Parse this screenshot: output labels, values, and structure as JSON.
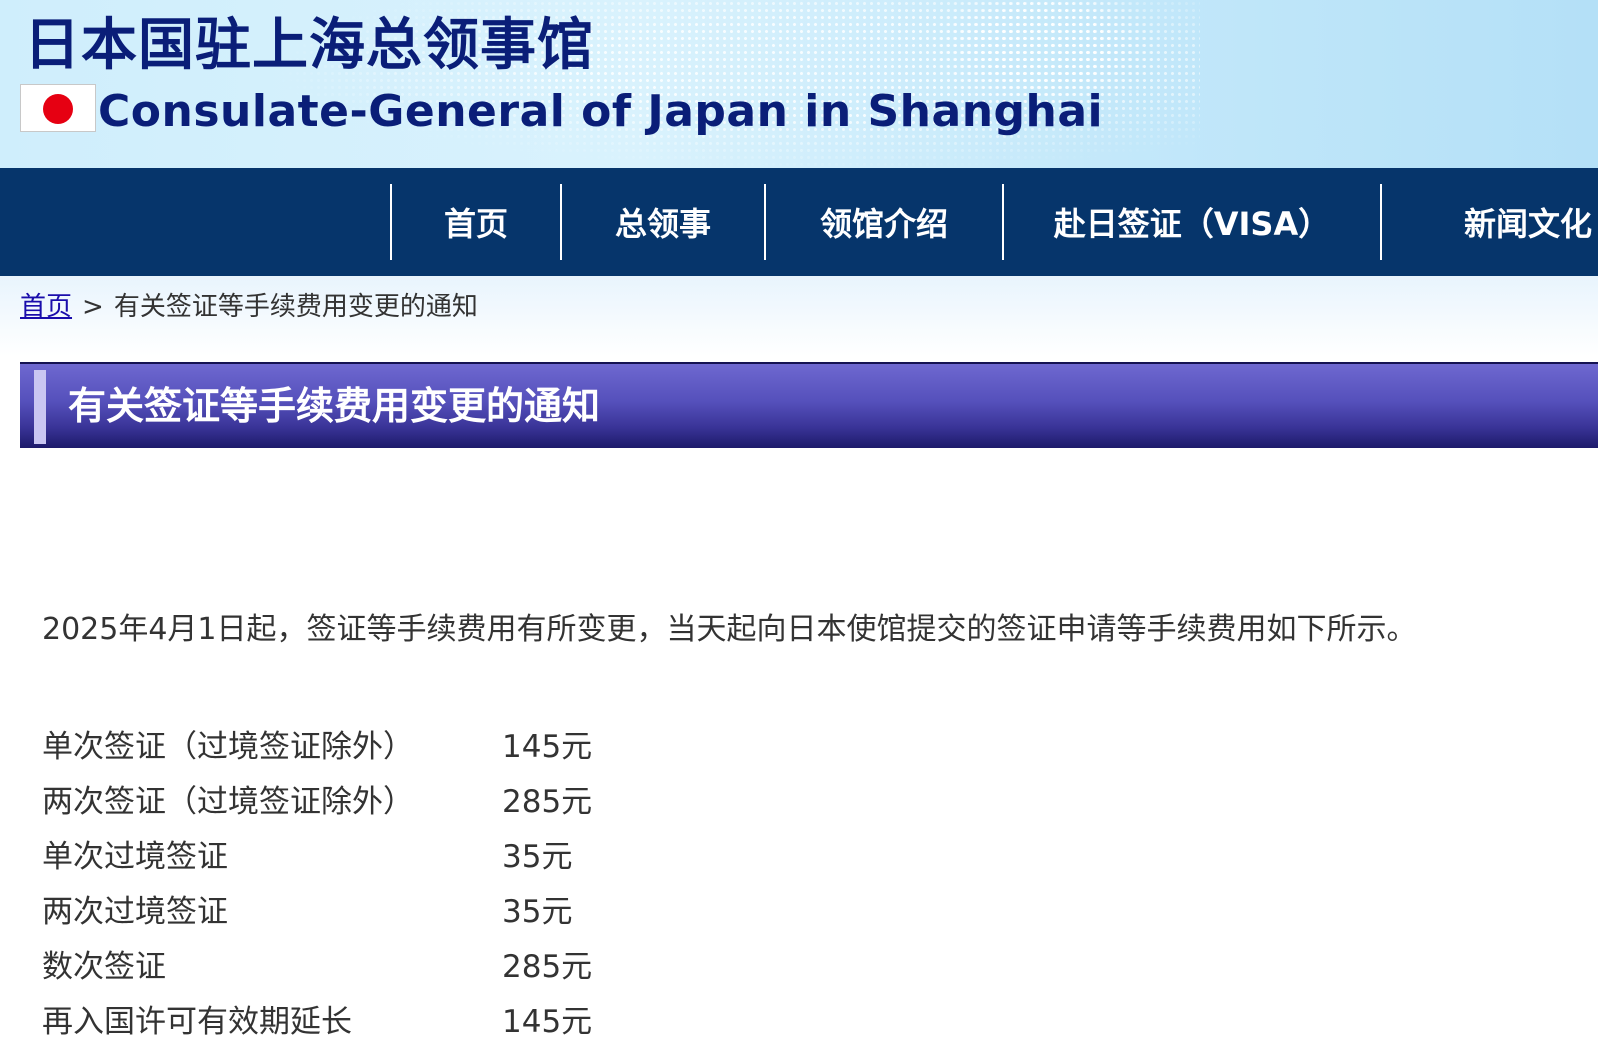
{
  "header": {
    "title_ja": "日本国驻上海总领事馆",
    "title_en": "Consulate-General of Japan in Shanghai",
    "flag_colors": {
      "field": "#ffffff",
      "sun": "#e60012"
    }
  },
  "nav": {
    "items": [
      {
        "label": "首页"
      },
      {
        "label": "总领事"
      },
      {
        "label": "领馆介绍"
      },
      {
        "label": "赴日签证（VISA）"
      },
      {
        "label": "新闻文化"
      }
    ],
    "background": "#06356b"
  },
  "breadcrumb": {
    "home": "首页",
    "separator": ">",
    "current": "有关签证等手续费用变更的通知"
  },
  "page": {
    "title": "有关签证等手续费用变更的通知",
    "intro": "2025年4月1日起，签证等手续费用有所变更，当天起向日本使馆提交的签证申请等手续费用如下所示。",
    "fees": [
      {
        "name": "单次签证（过境签证除外）",
        "price": "145元"
      },
      {
        "name": "两次签证（过境签证除外）",
        "price": "285元"
      },
      {
        "name": "单次过境签证",
        "price": "35元"
      },
      {
        "name": "两次过境签证",
        "price": "35元"
      },
      {
        "name": "数次签证",
        "price": "285元"
      },
      {
        "name": "再入国许可有效期延长",
        "price": "145元"
      }
    ]
  }
}
